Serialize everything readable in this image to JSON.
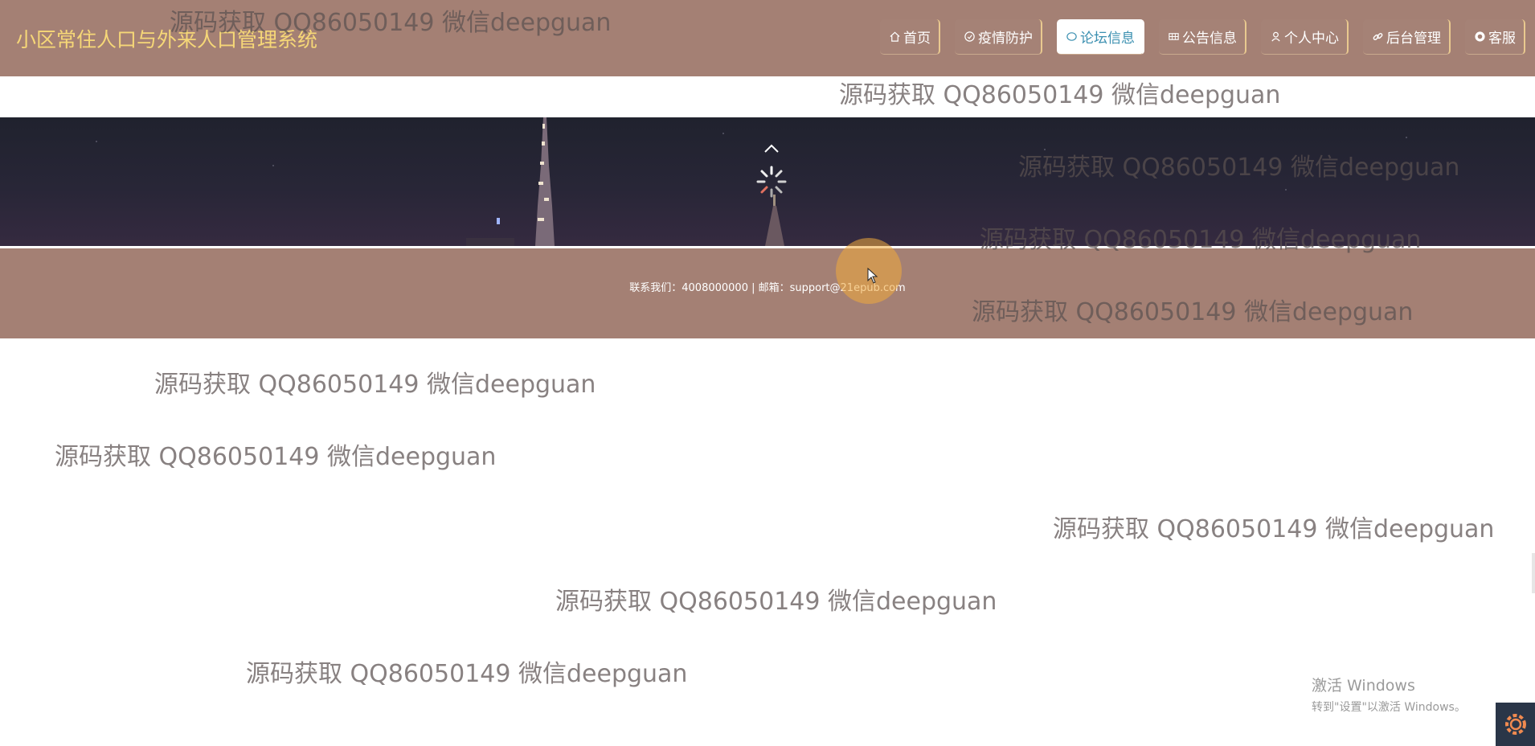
{
  "header": {
    "site_title": "小区常住人口与外来人口管理系统",
    "nav": [
      {
        "label": "首页",
        "icon": "home-icon",
        "active": false
      },
      {
        "label": "疫情防护",
        "icon": "shield-icon",
        "active": false
      },
      {
        "label": "论坛信息",
        "icon": "chat-icon",
        "active": true
      },
      {
        "label": "公告信息",
        "icon": "grid-icon",
        "active": false
      },
      {
        "label": "个人中心",
        "icon": "user-icon",
        "active": false
      },
      {
        "label": "后台管理",
        "icon": "link-icon",
        "active": false
      },
      {
        "label": "客服",
        "icon": "support-icon",
        "active": false
      }
    ]
  },
  "banner": {
    "nav_up_icon": "chevron-up-icon",
    "loading_icon": "spinner-icon"
  },
  "footer": {
    "contact_text": "联系我们：4008000000 | 邮箱：support@21epub.com"
  },
  "watermarks": [
    "源码获取 QQ86050149 微信deepguan",
    "源码获取 QQ86050149 微信deepguan",
    "源码获取 QQ86050149 微信deepguan",
    "源码获取 QQ86050149 微信deepguan",
    "源码获取 QQ86050149 微信deepguan",
    "源码获取 QQ86050149 微信deepguan",
    "源码获取 QQ86050149 微信deepguan",
    "源码获取 QQ86050149 微信deepguan",
    "源码获取 QQ86050149 微信deepguan",
    "源码获取 QQ86050149 微信deepguan"
  ],
  "windows_activation": {
    "line1": "激活 Windows",
    "line2": "转到\"设置\"以激活 Windows。"
  },
  "colors": {
    "header_bg": "#a48074",
    "title_color": "#f6d777",
    "active_nav_text": "#3a8fb0",
    "footer_bg": "#a48074",
    "banner_bg": "#24242f"
  }
}
